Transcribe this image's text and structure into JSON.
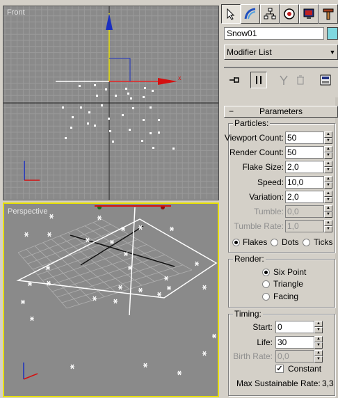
{
  "viewports": {
    "front_label": "Front",
    "perspective_label": "Perspective",
    "axis_x": "x"
  },
  "panel": {
    "object_name": "Snow01",
    "modifier_list": "Modifier List",
    "rollout_title": "Parameters",
    "particles": {
      "title": "Particles:",
      "viewport_count_label": "Viewport Count:",
      "viewport_count": "50",
      "render_count_label": "Render Count:",
      "render_count": "50",
      "flake_size_label": "Flake Size:",
      "flake_size": "2,0",
      "speed_label": "Speed:",
      "speed": "10,0",
      "variation_label": "Variation:",
      "variation": "2,0",
      "tumble_label": "Tumble:",
      "tumble": "0,0",
      "tumble_rate_label": "Tumble Rate:",
      "tumble_rate": "1,0",
      "flakes": "Flakes",
      "dots": "Dots",
      "ticks": "Ticks"
    },
    "render": {
      "title": "Render:",
      "six_point": "Six Point",
      "triangle": "Triangle",
      "facing": "Facing"
    },
    "timing": {
      "title": "Timing:",
      "start_label": "Start:",
      "start": "0",
      "life_label": "Life:",
      "life": "30",
      "birth_rate_label": "Birth Rate:",
      "birth_rate": "0,0",
      "constant": "Constant",
      "max_rate_label": "Max Sustainable Rate:",
      "max_rate": "3,3"
    }
  },
  "colors": {
    "viewport_bg": "#8a8a8a",
    "active_border": "#e8e000",
    "object_color": "#7fd8e0"
  }
}
